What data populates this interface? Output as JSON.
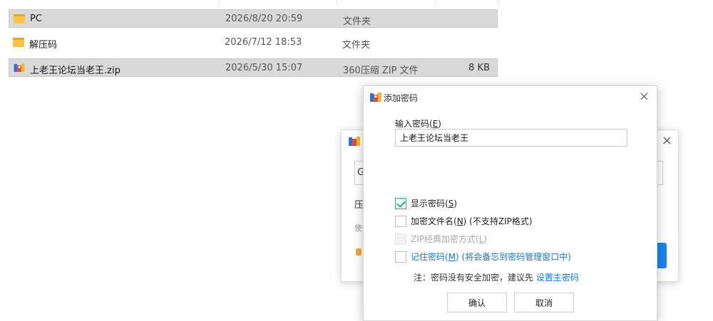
{
  "files": [
    {
      "name": "PC",
      "date": "2026/8/20 20:59",
      "type": "文件夹",
      "size": "",
      "icon": "folder-icon",
      "selected": true
    },
    {
      "name": "解压码",
      "date": "2026/7/12 18:53",
      "type": "文件夹",
      "size": "",
      "icon": "folder-icon",
      "selected": false
    },
    {
      "name": "上老王论坛当老王.zip",
      "date": "2026/5/30 15:07",
      "type": "360压缩 ZIP 文件",
      "size": "8 KB",
      "icon": "zip-archive-icon",
      "selected": true
    }
  ],
  "back_dialog": {
    "input_partial": "G",
    "text1": "压",
    "text2": "使",
    "close": "×"
  },
  "dialog": {
    "title": "添加密码",
    "close": "×",
    "password_label": "输入密码(",
    "password_label_key": "E",
    "password_label_end": ")",
    "password_value": "上老王论坛当老王",
    "show_password": {
      "label": "显示密码(",
      "key": "S",
      "end": ")"
    },
    "encrypt_names": {
      "label": "加密文件名(",
      "key": "N",
      "end": ") (不支持ZIP格式)"
    },
    "zip_classic": {
      "label": "ZIP经典加密方式(",
      "key": "L",
      "end": ")"
    },
    "remember": {
      "label": "记住密码(",
      "key": "M",
      "end": ") (将会备忘到密码管理窗口中)"
    },
    "note_prefix": "注：密码没有安全加密，建议先 ",
    "note_link": "设置主密码",
    "ok_label": "确认",
    "cancel_label": "取消"
  },
  "colors": {
    "accent": "#1677d2",
    "check": "#22b573",
    "selection": "#d9d9d9"
  }
}
